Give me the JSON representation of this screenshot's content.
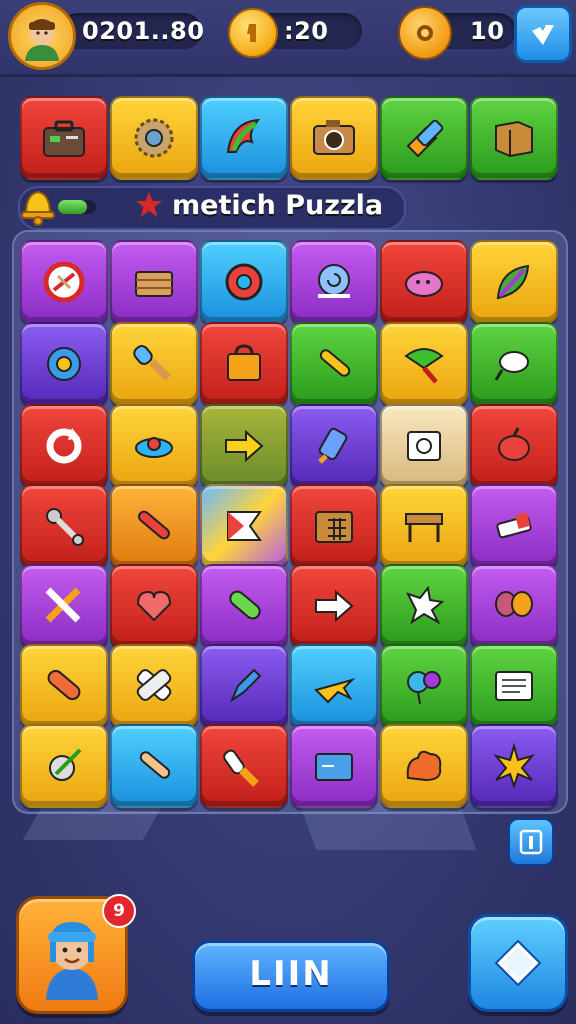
{
  "colors": {
    "red": "#e2312b",
    "yellow": "#f8c21a",
    "cyan": "#2bb4ef",
    "green": "#3bbf2c",
    "purple": "#a13ad8",
    "violet": "#6a3ad0",
    "orange": "#f79a17",
    "teal": "#2ec7d8"
  },
  "header": {
    "score": "0201..80",
    "coins": ":20",
    "gears": "10",
    "avatar_icon": "player-avatar-icon",
    "coin_icon": "coin-icon",
    "gear_icon": "gear-icon",
    "gem_icon": "gem-icon"
  },
  "shelf": [
    {
      "color": "red",
      "icon": "toolbox"
    },
    {
      "color": "yellow",
      "icon": "sawblade"
    },
    {
      "color": "cyan",
      "icon": "feather"
    },
    {
      "color": "yellow",
      "icon": "camera"
    },
    {
      "color": "green",
      "icon": "glue"
    },
    {
      "color": "green",
      "icon": "box"
    }
  ],
  "title_bar": {
    "title": "metich Puzzla",
    "progress": 0.75
  },
  "board": [
    [
      {
        "color": "purple",
        "icon": "no-sign"
      },
      {
        "color": "purple",
        "icon": "cake"
      },
      {
        "color": "cyan",
        "icon": "ring"
      },
      {
        "color": "purple",
        "icon": "snail"
      },
      {
        "color": "red",
        "icon": "blob"
      },
      {
        "color": "yellow",
        "icon": "leaf"
      }
    ],
    [
      {
        "color": "violet",
        "icon": "flower"
      },
      {
        "color": "yellow",
        "icon": "brush"
      },
      {
        "color": "red",
        "icon": "bag"
      },
      {
        "color": "green",
        "icon": "stick"
      },
      {
        "color": "yellow",
        "icon": "fan"
      },
      {
        "color": "green",
        "icon": "egg"
      }
    ],
    [
      {
        "color": "red",
        "icon": "refresh"
      },
      {
        "color": "yellow",
        "icon": "saucer"
      },
      {
        "color": "olive",
        "icon": "arrow-right"
      },
      {
        "color": "violet",
        "icon": "rocket"
      },
      {
        "color": "cream",
        "icon": "photo"
      },
      {
        "color": "red",
        "icon": "apple"
      }
    ],
    [
      {
        "color": "red",
        "icon": "wrench"
      },
      {
        "color": "orange",
        "icon": "stick-red"
      },
      {
        "color": "rainbow",
        "icon": "flag"
      },
      {
        "color": "red",
        "icon": "grid-box"
      },
      {
        "color": "yellow",
        "icon": "table"
      },
      {
        "color": "purple",
        "icon": "eraser"
      }
    ],
    [
      {
        "color": "purple",
        "icon": "cross-tools"
      },
      {
        "color": "red",
        "icon": "heart-pin"
      },
      {
        "color": "purple",
        "icon": "pickle"
      },
      {
        "color": "red",
        "icon": "arrow-right-white"
      },
      {
        "color": "green",
        "icon": "splat"
      },
      {
        "color": "purple",
        "icon": "bow"
      }
    ],
    [
      {
        "color": "yellow",
        "icon": "pill"
      },
      {
        "color": "yellow",
        "icon": "bandage"
      },
      {
        "color": "violet",
        "icon": "pen"
      },
      {
        "color": "cyan",
        "icon": "plane"
      },
      {
        "color": "green",
        "icon": "balloons"
      },
      {
        "color": "green",
        "icon": "note"
      }
    ],
    [
      {
        "color": "yellow",
        "icon": "clock-pen"
      },
      {
        "color": "cyan",
        "icon": "bone"
      },
      {
        "color": "red",
        "icon": "brush-white"
      },
      {
        "color": "purple",
        "icon": "folder"
      },
      {
        "color": "yellow",
        "icon": "coral"
      },
      {
        "color": "violet",
        "icon": "sun-burst"
      }
    ]
  ],
  "bottom": {
    "notification_count": "9",
    "main_button_label": "LIIN",
    "profile_icon": "character-portrait-icon",
    "right_icon": "diamond-icon",
    "info_icon": "info-icon"
  }
}
